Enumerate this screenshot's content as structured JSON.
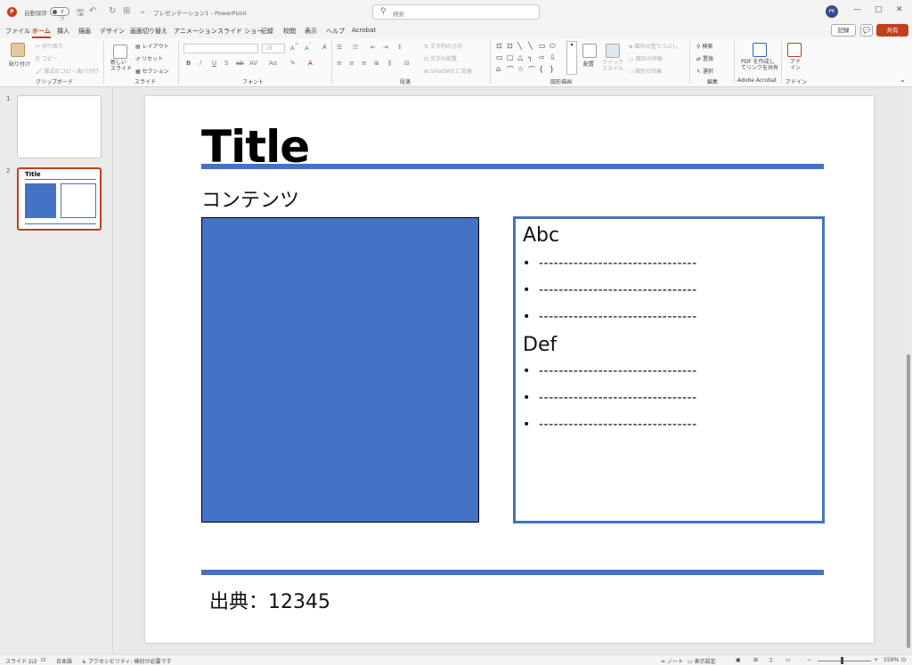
{
  "titlebar": {
    "autosave_label": "自動保存",
    "toggle_state": "オフ",
    "doc_title": "プレゼンテーション1 - PowerPoint",
    "search_placeholder": "検索",
    "avatar_initials": "PK"
  },
  "tabs": [
    "ファイル",
    "ホーム",
    "挿入",
    "描画",
    "デザイン",
    "画面切り替え",
    "アニメーション",
    "スライド ショー",
    "記録",
    "校閲",
    "表示",
    "ヘルプ",
    "Acrobat"
  ],
  "active_tab": "ホーム",
  "top_actions": {
    "record": "記録",
    "share": "共有"
  },
  "ribbon": {
    "clipboard": {
      "paste": "貼り付け",
      "cut": "切り取り",
      "copy": "コピー",
      "format_painter": "書式のコピー/貼り付け",
      "label": "クリップボード"
    },
    "slides": {
      "new_slide": "新しい\nスライド",
      "layout": "レイアウト",
      "reset": "リセット",
      "section": "セクション",
      "label": "スライド"
    },
    "font": {
      "font_size": "18",
      "label": "フォント"
    },
    "paragraph": {
      "text_direction": "文字列の方向",
      "align_text": "文字の配置",
      "smartart": "SmartArt に変換",
      "label": "段落"
    },
    "drawing": {
      "arrange": "配置",
      "quick_styles": "クイック\nスタイル",
      "shape_fill": "図形の塗りつぶし",
      "shape_outline": "図形の枠線",
      "shape_effects": "図形の効果",
      "label": "図形描画"
    },
    "editing": {
      "find": "検索",
      "replace": "置換",
      "select": "選択",
      "label": "編集"
    },
    "acrobat": {
      "create_pdf": "PDF を作成し\nてリンクを共有",
      "label": "Adobe Acrobat"
    },
    "addins": {
      "addin": "アド\nイン",
      "label": "アドイン"
    }
  },
  "thumbnails": [
    {
      "number": "1"
    },
    {
      "number": "2",
      "title": "Title"
    }
  ],
  "slide": {
    "title": "Title",
    "subtitle": "コンテンツ",
    "box_colors": {
      "accent": "#4472c4"
    },
    "text_box": {
      "heading1": "Abc",
      "heading2": "Def",
      "bullets1": [
        "--------------------------------",
        "--------------------------------",
        "--------------------------------"
      ],
      "bullets2": [
        "--------------------------------",
        "--------------------------------",
        "--------------------------------"
      ]
    },
    "source": "出典：12345"
  },
  "status": {
    "slide_count": "スライド 2/2",
    "language": "日本語",
    "accessibility": "アクセシビリティ: 検討が必要です",
    "notes": "ノート",
    "display_settings": "表示設定",
    "zoom": "159%"
  }
}
